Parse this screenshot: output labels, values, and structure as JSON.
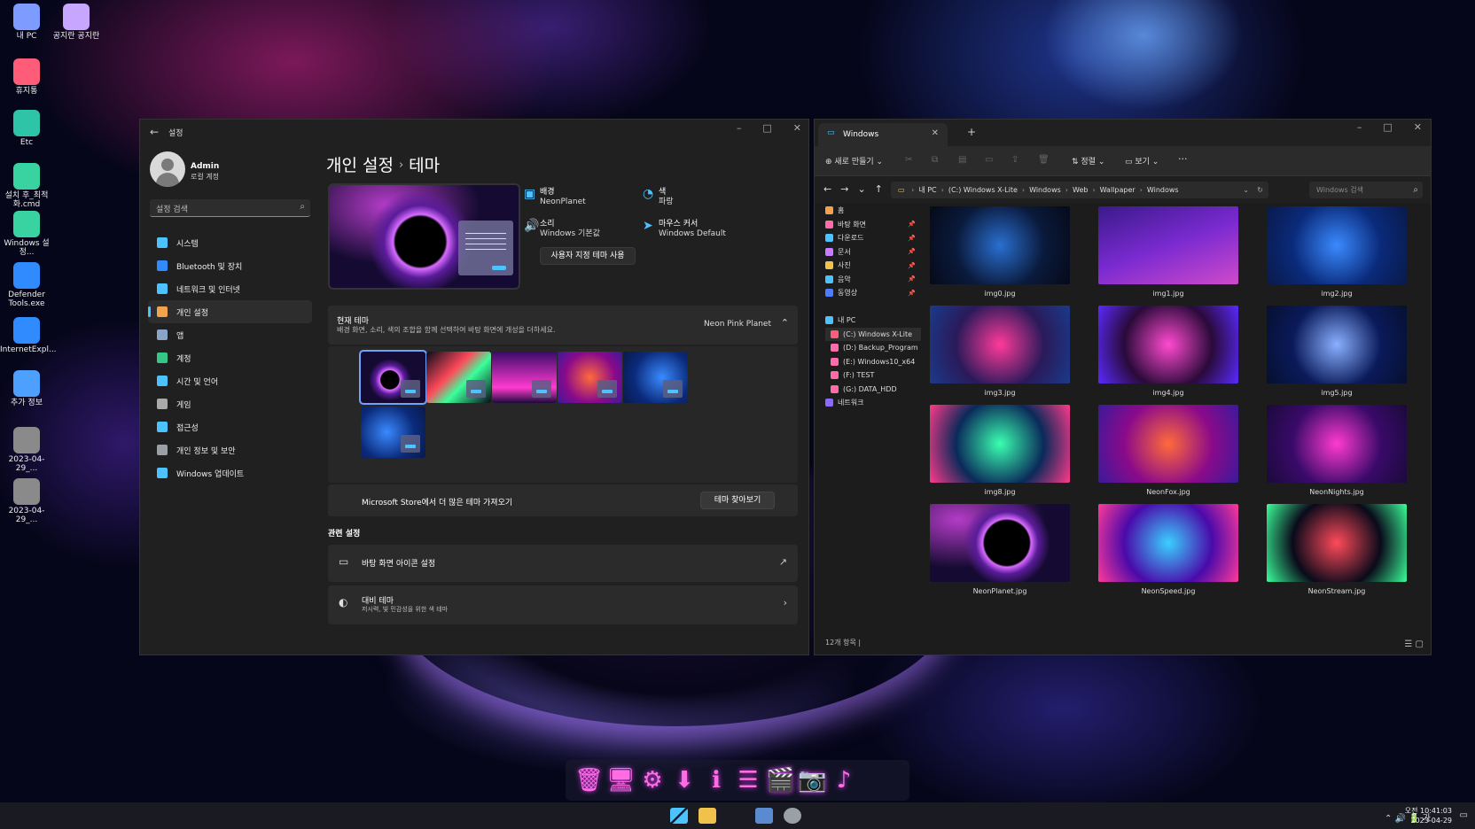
{
  "desktop": {
    "icons": [
      {
        "label": "내 PC",
        "color": "#7e9bff"
      },
      {
        "label": "공지란 공지란",
        "color": "#c7a6ff"
      },
      {
        "label": "휴지통",
        "color": "#ff5c7a"
      },
      {
        "label": "Etc",
        "color": "#2ec4a8"
      },
      {
        "label": "설치 후_최적화.cmd",
        "color": "#39d3a2"
      },
      {
        "label": "Windows 설정...",
        "color": "#39d3a2"
      },
      {
        "label": "Defender Tools.exe",
        "color": "#2f8bff"
      },
      {
        "label": "InternetExpl...",
        "color": "#2f8bff"
      },
      {
        "label": "추가 정보",
        "color": "#4ea0ff"
      },
      {
        "label": "2023-04-29_...",
        "color": "#8a8a8a"
      },
      {
        "label": "2023-04-29_...",
        "color": "#8a8a8a"
      }
    ]
  },
  "settings": {
    "title": "설정",
    "user": {
      "name": "Admin",
      "type": "로컬 계정"
    },
    "search_placeholder": "설정 검색",
    "nav": [
      {
        "label": "시스템",
        "icon": "monitor-icon",
        "color": "#4cc2ff"
      },
      {
        "label": "Bluetooth 및 장치",
        "icon": "bluetooth-icon",
        "color": "#2f8bff"
      },
      {
        "label": "네트워크 및 인터넷",
        "icon": "wifi-icon",
        "color": "#4cc2ff"
      },
      {
        "label": "개인 설정",
        "icon": "brush-icon",
        "color": "#f0a24c"
      },
      {
        "label": "앱",
        "icon": "apps-icon",
        "color": "#8aa4c8"
      },
      {
        "label": "계정",
        "icon": "person-icon",
        "color": "#35c786"
      },
      {
        "label": "시간 및 언어",
        "icon": "globe-clock-icon",
        "color": "#4cc2ff"
      },
      {
        "label": "게임",
        "icon": "gamepad-icon",
        "color": "#aaaaaa"
      },
      {
        "label": "접근성",
        "icon": "accessibility-icon",
        "color": "#4cc2ff"
      },
      {
        "label": "개인 정보 및 보안",
        "icon": "shield-icon",
        "color": "#9aa0a6"
      },
      {
        "label": "Windows 업데이트",
        "icon": "update-icon",
        "color": "#4cc2ff"
      }
    ],
    "breadcrumb": {
      "parent": "개인 설정",
      "separator": "›",
      "current": "테마"
    },
    "props": {
      "background": {
        "title": "배경",
        "value": "NeonPlanet"
      },
      "color": {
        "title": "색",
        "value": "파랑"
      },
      "sound": {
        "title": "소리",
        "value": "Windows 기본값"
      },
      "cursor": {
        "title": "마우스 커서",
        "value": "Windows Default"
      }
    },
    "custom_theme_button": "사용자 지정 테마 사용",
    "current_theme": {
      "title": "현재 테마",
      "description": "배경 화면, 소리, 색의 조합을 함께 선택하여 바탕 화면에 개성을 더하세요.",
      "value": "Neon Pink Planet"
    },
    "store": {
      "label": "Microsoft Store에서 더 많은 테마 가져오기",
      "button": "테마 찾아보기"
    },
    "related": {
      "title": "관련 설정",
      "desktop_icons": "바탕 화면 아이콘 설정",
      "contrast_title": "대비 테마",
      "contrast_sub": "저시력, 빛 민감성을 위한 색 테마"
    }
  },
  "explorer": {
    "tab_title": "Windows",
    "toolbar": {
      "new": "새로 만들기",
      "sort": "정렬",
      "view": "보기",
      "more": "···"
    },
    "address": [
      "내 PC",
      "(C:) Windows X-Lite",
      "Windows",
      "Web",
      "Wallpaper",
      "Windows"
    ],
    "search_placeholder": "Windows 검색",
    "tree": [
      {
        "label": "홈",
        "color": "#f0a24c",
        "pinned": false
      },
      {
        "label": "바탕 화면",
        "color": "#ff6aa8",
        "pinned": true
      },
      {
        "label": "다운로드",
        "color": "#4cc2ff",
        "pinned": true
      },
      {
        "label": "문서",
        "color": "#c77dff",
        "pinned": true
      },
      {
        "label": "사진",
        "color": "#f0c24c",
        "pinned": true
      },
      {
        "label": "음악",
        "color": "#4cc2ff",
        "pinned": true
      },
      {
        "label": "동영상",
        "color": "#4c7dff",
        "pinned": true
      },
      {
        "label": "",
        "color": "",
        "pinned": false
      },
      {
        "label": "내 PC",
        "color": "#4cc2ff",
        "pinned": false
      },
      {
        "label": "(C:) Windows X-Lite",
        "color": "#ff5c7a",
        "pinned": false
      },
      {
        "label": "(D:) Backup_Program",
        "color": "#ff6aa8",
        "pinned": false
      },
      {
        "label": "(E:) Windows10_x64",
        "color": "#ff6aa8",
        "pinned": false
      },
      {
        "label": "(F:) TEST",
        "color": "#ff6aa8",
        "pinned": false
      },
      {
        "label": "(G:) DATA_HDD",
        "color": "#ff6aa8",
        "pinned": false
      },
      {
        "label": "네트워크",
        "color": "#8a6aff",
        "pinned": false
      }
    ],
    "files": [
      {
        "name": "img0.jpg",
        "colors": [
          "#0a1a3c",
          "#2a6fd0",
          "#060a18"
        ]
      },
      {
        "name": "img1.jpg",
        "colors": [
          "#3a1a8a",
          "#d04acb",
          "#7a2ad0"
        ]
      },
      {
        "name": "img2.jpg",
        "colors": [
          "#0a2a7a",
          "#3a8aff",
          "#0a1a4a"
        ]
      },
      {
        "name": "img3.jpg",
        "colors": [
          "#2a1a5a",
          "#ff3a9a",
          "#1a3a8a"
        ]
      },
      {
        "name": "img4.jpg",
        "colors": [
          "#2a0a3a",
          "#ff4ad0",
          "#5a2aff"
        ]
      },
      {
        "name": "img5.jpg",
        "colors": [
          "#0a1a5a",
          "#8ab0ff",
          "#061030"
        ]
      },
      {
        "name": "img8.jpg",
        "colors": [
          "#0a2a5a",
          "#3affb0",
          "#ff3a8a"
        ]
      },
      {
        "name": "NeonFox.jpg",
        "colors": [
          "#8a0a8a",
          "#ff6a3a",
          "#3a1a9a"
        ]
      },
      {
        "name": "NeonNights.jpg",
        "colors": [
          "#3a0a6a",
          "#ff3ad0",
          "#1a0a3a"
        ]
      },
      {
        "name": "NeonPlanet.jpg",
        "colors": [
          "#1a0a3a",
          "#d86bff",
          "#050510"
        ]
      },
      {
        "name": "NeonSpeed.jpg",
        "colors": [
          "#4a0aaa",
          "#3ad0ff",
          "#ff3a9a"
        ]
      },
      {
        "name": "NeonStream.jpg",
        "colors": [
          "#0a0a1a",
          "#ff4a5a",
          "#3aff9a"
        ]
      }
    ],
    "status": "12개 항목  |"
  },
  "dock": [
    "🗑",
    "🖥",
    "⚙",
    "⬇",
    "ℹ",
    "☰",
    "🎬",
    "📷",
    "♪"
  ],
  "taskbar": {
    "tray": "⌃  🔊 🔋 가",
    "time": "오전 10:41:03",
    "date": "2023-04-29"
  }
}
